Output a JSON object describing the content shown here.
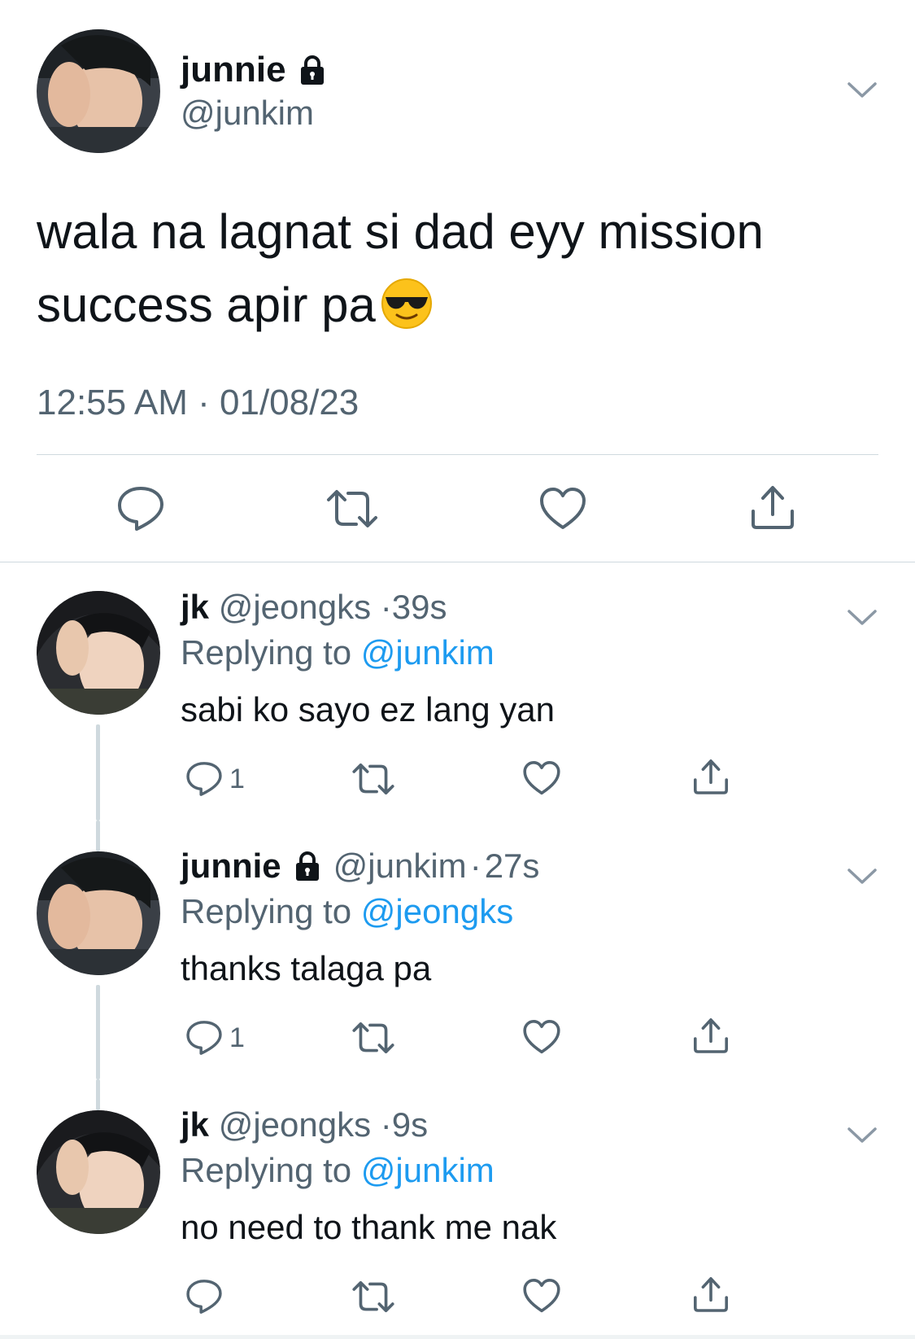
{
  "main_tweet": {
    "display_name": "junnie",
    "handle": "@junkim",
    "text": "wala na lagnat si dad eyy mission success apir pa",
    "emoji": "smiling-face-with-sunglasses",
    "timestamp": "12:55 AM · 01/08/23"
  },
  "replies": [
    {
      "display_name": "jk",
      "handle": "@jeongks",
      "time": "39s",
      "replying_prefix": "Replying to",
      "replying_to": "@junkim",
      "text": "sabi ko sayo ez lang yan",
      "reply_count": "1",
      "locked": false
    },
    {
      "display_name": "junnie",
      "handle": "@junkim",
      "time": "27s",
      "replying_prefix": "Replying to",
      "replying_to": "@jeongks",
      "text": "thanks talaga pa",
      "reply_count": "1",
      "locked": true
    },
    {
      "display_name": "jk",
      "handle": "@jeongks",
      "time": "9s",
      "replying_prefix": "Replying to",
      "replying_to": "@junkim",
      "text": "no need to thank me nak",
      "reply_count": "",
      "locked": false
    }
  ],
  "icons": {
    "reply": "reply-bubble-icon",
    "retweet": "retweet-icon",
    "like": "heart-icon",
    "share": "share-icon",
    "more": "chevron-down-icon",
    "lock": "lock-icon"
  },
  "colors": {
    "text": "#0f1419",
    "secondary": "#536471",
    "link": "#1d9bf0",
    "divider": "#cfd9de"
  },
  "separator": "·"
}
